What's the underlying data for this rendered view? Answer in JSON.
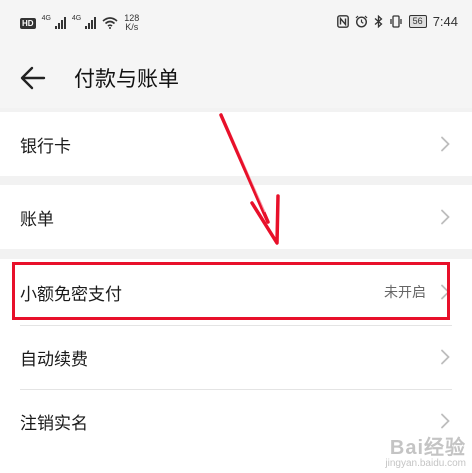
{
  "status_bar": {
    "hd": "HD",
    "net1": "4G",
    "net2": "4G",
    "speed_value": "128",
    "speed_unit": "K/s",
    "battery": "56",
    "time": "7:44"
  },
  "header": {
    "title": "付款与账单",
    "back_icon": "arrow-left-icon"
  },
  "rows": [
    {
      "label": "银行卡",
      "value": ""
    },
    {
      "label": "账单",
      "value": ""
    },
    {
      "label": "小额免密支付",
      "value": "未开启"
    },
    {
      "label": "自动续费",
      "value": ""
    },
    {
      "label": "注销实名",
      "value": ""
    }
  ],
  "annotation": {
    "color": "#e8102a",
    "highlighted_row": "小额免密支付"
  },
  "watermark": {
    "main": "Bai经验",
    "sub": "jingyan.baidu.com"
  },
  "colors": {
    "background": "#f2f2f2",
    "surface": "#ffffff",
    "accent": "#e8102a"
  }
}
